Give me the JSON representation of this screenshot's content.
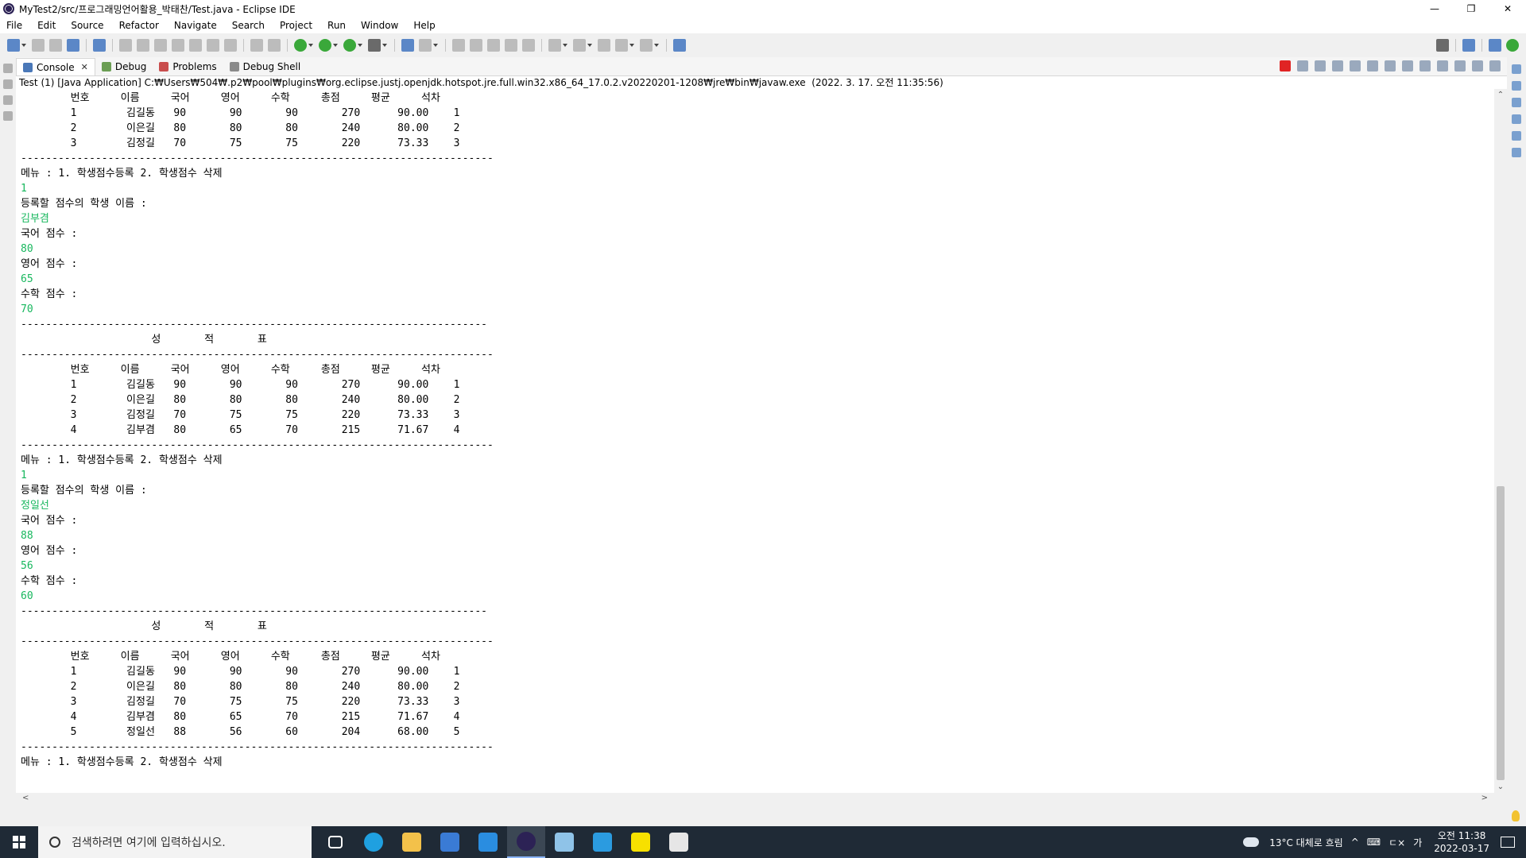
{
  "window": {
    "title": "MyTest2/src/프로그래밍언어활용_박태찬/Test.java - Eclipse IDE",
    "min_glyph": "—",
    "max_glyph": "❐",
    "close_glyph": "✕"
  },
  "menu": [
    "File",
    "Edit",
    "Source",
    "Refactor",
    "Navigate",
    "Search",
    "Project",
    "Run",
    "Window",
    "Help"
  ],
  "tabs": [
    {
      "label": "Console",
      "icon": "console-icon",
      "active": true
    },
    {
      "label": "Debug",
      "icon": "debug-icon",
      "active": false
    },
    {
      "label": "Problems",
      "icon": "problems-icon",
      "active": false
    },
    {
      "label": "Debug Shell",
      "icon": "debug-shell-icon",
      "active": false
    }
  ],
  "tab_close_glyph": "✕",
  "console_description": "Test (1) [Java Application] C:₩Users₩504₩.p2₩pool₩plugins₩org.eclipse.justj.openjdk.hotspot.jre.full.win32.x86_64_17.0.2.v20220201-1208₩jre₩bin₩javaw.exe  (2022. 3. 17. 오전 11:35:56)",
  "console_lines": [
    {
      "t": "        번호     이름     국어     영어     수학     총점     평균     석차",
      "input": false
    },
    {
      "t": "        1        김길동   90       90       90       270      90.00    1",
      "input": false
    },
    {
      "t": "        2        이은길   80       80       80       240      80.00    2",
      "input": false
    },
    {
      "t": "        3        김정길   70       75       75       220      73.33    3",
      "input": false
    },
    {
      "t": "----------------------------------------------------------------------------",
      "input": false
    },
    {
      "t": "메뉴 : 1. 학생점수등록 2. 학생점수 삭제",
      "input": false
    },
    {
      "t": "1",
      "input": true
    },
    {
      "t": "등록할 점수의 학생 이름 :",
      "input": false
    },
    {
      "t": "김부겸",
      "input": true
    },
    {
      "t": "국어 점수 :",
      "input": false
    },
    {
      "t": "80",
      "input": true
    },
    {
      "t": "영어 점수 :",
      "input": false
    },
    {
      "t": "65",
      "input": true
    },
    {
      "t": "수학 점수 :",
      "input": false
    },
    {
      "t": "70",
      "input": true
    },
    {
      "t": "---------------------------------------------------------------------------",
      "input": false
    },
    {
      "t": "                     성       적       표",
      "input": false
    },
    {
      "t": "----------------------------------------------------------------------------",
      "input": false
    },
    {
      "t": "        번호     이름     국어     영어     수학     총점     평균     석차",
      "input": false
    },
    {
      "t": "        1        김길동   90       90       90       270      90.00    1",
      "input": false
    },
    {
      "t": "        2        이은길   80       80       80       240      80.00    2",
      "input": false
    },
    {
      "t": "        3        김정길   70       75       75       220      73.33    3",
      "input": false
    },
    {
      "t": "        4        김부겸   80       65       70       215      71.67    4",
      "input": false
    },
    {
      "t": "----------------------------------------------------------------------------",
      "input": false
    },
    {
      "t": "메뉴 : 1. 학생점수등록 2. 학생점수 삭제",
      "input": false
    },
    {
      "t": "1",
      "input": true
    },
    {
      "t": "등록할 점수의 학생 이름 :",
      "input": false
    },
    {
      "t": "정일선",
      "input": true
    },
    {
      "t": "국어 점수 :",
      "input": false
    },
    {
      "t": "88",
      "input": true
    },
    {
      "t": "영어 점수 :",
      "input": false
    },
    {
      "t": "56",
      "input": true
    },
    {
      "t": "수학 점수 :",
      "input": false
    },
    {
      "t": "60",
      "input": true
    },
    {
      "t": "---------------------------------------------------------------------------",
      "input": false
    },
    {
      "t": "                     성       적       표",
      "input": false
    },
    {
      "t": "----------------------------------------------------------------------------",
      "input": false
    },
    {
      "t": "        번호     이름     국어     영어     수학     총점     평균     석차",
      "input": false
    },
    {
      "t": "        1        김길동   90       90       90       270      90.00    1",
      "input": false
    },
    {
      "t": "        2        이은길   80       80       80       240      80.00    2",
      "input": false
    },
    {
      "t": "        3        김정길   70       75       75       220      73.33    3",
      "input": false
    },
    {
      "t": "        4        김부겸   80       65       70       215      71.67    4",
      "input": false
    },
    {
      "t": "        5        정일선   88       56       60       204      68.00    5",
      "input": false
    },
    {
      "t": "----------------------------------------------------------------------------",
      "input": false
    },
    {
      "t": "메뉴 : 1. 학생점수등록 2. 학생점수 삭제",
      "input": false
    }
  ],
  "scroll": {
    "up_glyph": "⌃",
    "down_glyph": "⌄",
    "left_glyph": "<",
    "right_glyph": ">"
  },
  "taskbar": {
    "search_placeholder": "검색하려면 여기에 입력하십시오.",
    "apps": [
      {
        "name": "task-view-icon",
        "color": "#1f2a36"
      },
      {
        "name": "edge-icon",
        "color": "#1fa0e0"
      },
      {
        "name": "file-explorer-icon",
        "color": "#f3c14a"
      },
      {
        "name": "store-icon",
        "color": "#3a7bd5"
      },
      {
        "name": "mail-icon",
        "color": "#2a8de0"
      },
      {
        "name": "eclipse-icon",
        "color": "#2c2255"
      },
      {
        "name": "notepad-icon",
        "color": "#8fc3e8"
      },
      {
        "name": "app-blue-icon",
        "color": "#2b9be0"
      },
      {
        "name": "kakaotalk-icon",
        "color": "#f7e000"
      },
      {
        "name": "paint-icon",
        "color": "#e6e6e6"
      }
    ],
    "weather": "13°C 대체로 흐림",
    "tray_up_glyph": "^",
    "tray_network_glyph": "⌨",
    "tray_volume": "ㄷ×",
    "ime": "가",
    "time": "오전 11:38",
    "date": "2022-03-17"
  }
}
